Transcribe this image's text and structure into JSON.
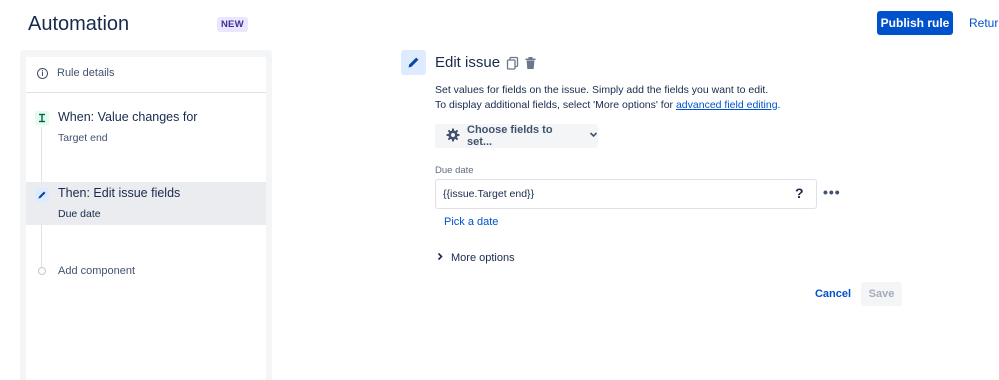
{
  "header": {
    "title": "Automation",
    "badge": "NEW",
    "publish_label": "Publish rule",
    "return_label": "Return"
  },
  "sidebar": {
    "rule_details_label": "Rule details",
    "trigger": {
      "title": "When: Value changes for",
      "subtitle": "Target end"
    },
    "action": {
      "title": "Then: Edit issue fields",
      "subtitle": "Due date"
    },
    "add_component_label": "Add component"
  },
  "editor": {
    "title": "Edit issue",
    "desc_line1": "Set values for fields on the issue. Simply add the fields you want to edit.",
    "desc_line2_prefix": "To display additional fields, select 'More options' for ",
    "desc_line2_link": "advanced field editing",
    "desc_line2_suffix": ".",
    "choose_fields_label": "Choose fields to set...",
    "due_date_label": "Due date",
    "due_date_value": "{{issue.Target end}}",
    "help_glyph": "?",
    "more_glyph": "•••",
    "pick_date_label": "Pick a date",
    "more_options_label": "More options",
    "cancel_label": "Cancel",
    "save_label": "Save"
  },
  "icons": {
    "info": "info-icon",
    "trigger": "trigger-icon",
    "pencil": "pencil-icon",
    "copy": "copy-icon",
    "trash": "trash-icon",
    "gear": "gear-icon",
    "chevron_down": "chevron-down-icon",
    "chevron_right": "chevron-right-icon",
    "help": "help-icon",
    "more": "more-icon"
  },
  "colors": {
    "primary": "#0052cc",
    "text": "#172b4d",
    "muted": "#42526e",
    "badge_bg": "#eae6ff",
    "badge_text": "#403294",
    "trigger_bg": "#e3fcef",
    "action_bg": "#deebff"
  }
}
